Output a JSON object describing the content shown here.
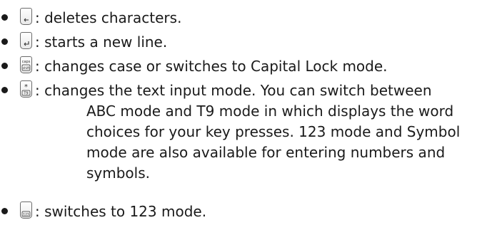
{
  "items": [
    {
      "key_icon": "backspace-key-icon",
      "text": ": deletes characters."
    },
    {
      "key_icon": "enter-key-icon",
      "text": ": starts a new line."
    },
    {
      "key_icon": "caps-shift-key-icon",
      "key_label_top": "caps",
      "key_label_bottom": "shift",
      "text": ": changes case or switches to Capital Lock mode."
    },
    {
      "key_icon": "star-t9-key-icon",
      "key_label_top": "*",
      "key_label_bottom": "T9",
      "lines": [
        ": changes the text input mode. You can switch between",
        "ABC mode and T9 mode in which displays the word",
        "choices for your key presses. 123 mode and Symbol",
        "mode are also available for entering numbers and",
        "symbols."
      ]
    },
    {
      "key_icon": "123-key-icon",
      "key_label_bottom": "123",
      "text": ": switches to 123 mode."
    }
  ]
}
